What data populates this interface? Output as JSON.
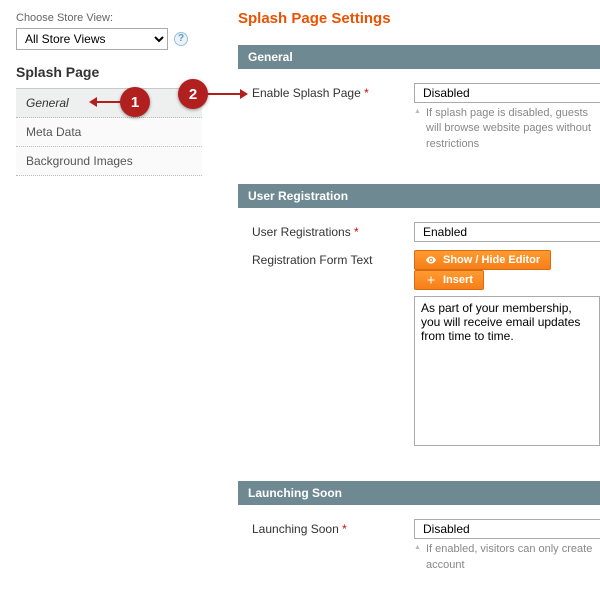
{
  "store_view": {
    "label": "Choose Store View:",
    "selected": "All Store Views"
  },
  "sidebar": {
    "title": "Splash Page",
    "items": [
      {
        "label": "General",
        "active": true
      },
      {
        "label": "Meta Data",
        "active": false
      },
      {
        "label": "Background Images",
        "active": false
      }
    ]
  },
  "page_title": "Splash Page Settings",
  "sections": {
    "general": {
      "heading": "General",
      "enable_label": "Enable Splash Page",
      "enable_value": "Disabled",
      "enable_note": "If splash page is disabled, guests will browse website pages without restrictions"
    },
    "user_reg": {
      "heading": "User Registration",
      "reg_label": "User Registrations",
      "reg_value": "Enabled",
      "form_text_label": "Registration Form Text",
      "show_hide_label": "Show / Hide Editor",
      "insert_label": "Insert",
      "textarea_value": "As part of your membership, you will receive email updates from time to time."
    },
    "launching": {
      "heading": "Launching Soon",
      "label": "Launching Soon",
      "value": "Disabled",
      "note": "If enabled, visitors can only create account"
    }
  },
  "annotations": {
    "b1": "1",
    "b2": "2"
  }
}
